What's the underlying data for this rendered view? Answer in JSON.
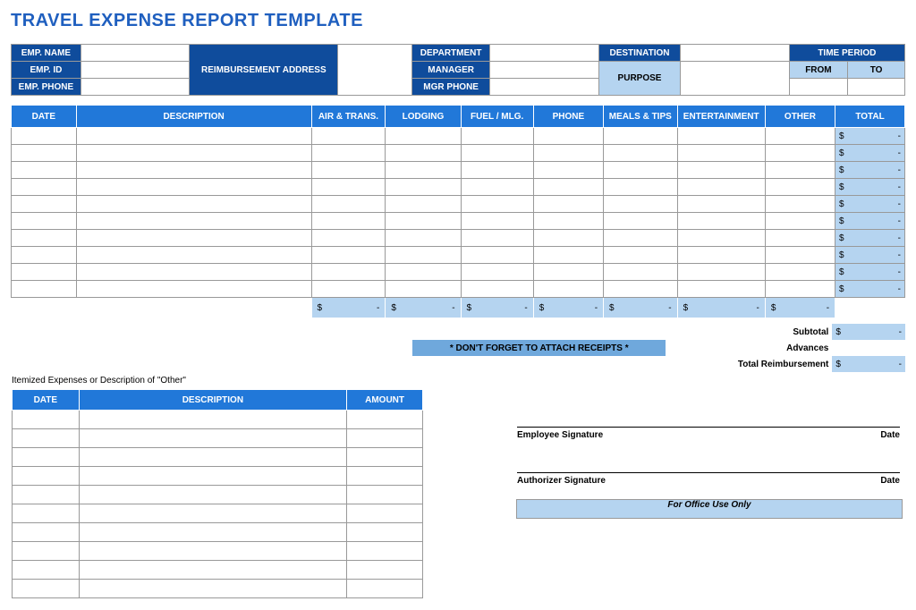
{
  "title": "TRAVEL EXPENSE REPORT TEMPLATE",
  "hdr": {
    "emp_name": "EMP. NAME",
    "emp_id": "EMP. ID",
    "emp_phone": "EMP. PHONE",
    "reimb_addr": "REIMBURSEMENT ADDRESS",
    "department": "DEPARTMENT",
    "manager": "MANAGER",
    "mgr_phone": "MGR PHONE",
    "destination": "DESTINATION",
    "purpose": "PURPOSE",
    "time_period": "TIME PERIOD",
    "from": "FROM",
    "to": "TO"
  },
  "cols": {
    "date": "DATE",
    "desc": "DESCRIPTION",
    "air": "AIR & TRANS.",
    "lodging": "LODGING",
    "fuel": "FUEL / MLG.",
    "phone": "PHONE",
    "meals": "MEALS & TIPS",
    "ent": "ENTERTAINMENT",
    "other": "OTHER",
    "total": "TOTAL"
  },
  "total_placeholder_dollar": "$",
  "total_placeholder_dash": "-",
  "reminder": "* DON'T FORGET TO ATTACH RECEIPTS *",
  "subtotal": "Subtotal",
  "advances": "Advances",
  "total_reimb": "Total Reimbursement",
  "itemized_caption": "Itemized Expenses or Description of \"Other\"",
  "itemized": {
    "date": "DATE",
    "desc": "DESCRIPTION",
    "amount": "AMOUNT"
  },
  "sig": {
    "emp": "Employee Signature",
    "auth": "Authorizer Signature",
    "date_lbl": "Date"
  },
  "office": "For Office Use Only"
}
